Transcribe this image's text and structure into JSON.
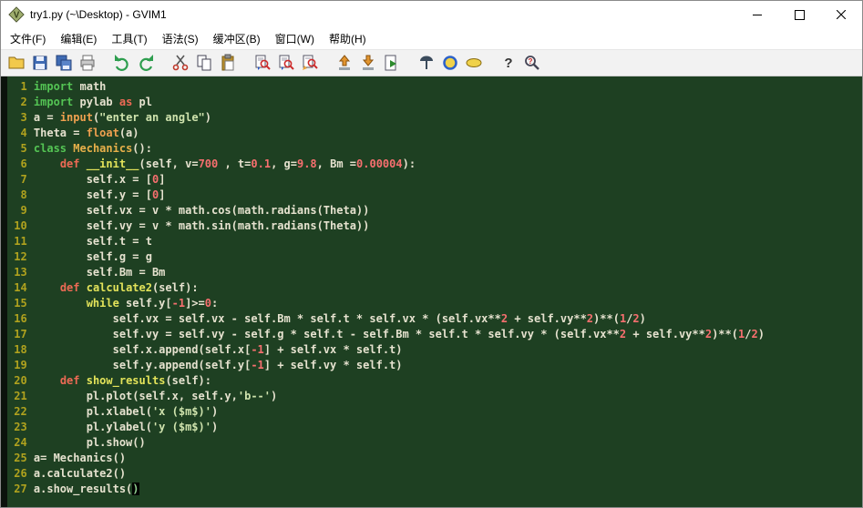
{
  "window": {
    "title": "try1.py (~\\Desktop) - GVIM1",
    "controls": [
      "minimize",
      "maximize",
      "close"
    ]
  },
  "menu": {
    "items": [
      {
        "key": "file",
        "label": "文件(F)"
      },
      {
        "key": "edit",
        "label": "编辑(E)"
      },
      {
        "key": "tools",
        "label": "工具(T)"
      },
      {
        "key": "syntax",
        "label": "语法(S)"
      },
      {
        "key": "buffers",
        "label": "缓冲区(B)"
      },
      {
        "key": "window",
        "label": "窗口(W)"
      },
      {
        "key": "help",
        "label": "帮助(H)"
      }
    ]
  },
  "toolbar": {
    "buttons": [
      {
        "name": "open",
        "icon": "open",
        "gap": false
      },
      {
        "name": "save",
        "icon": "save",
        "gap": false
      },
      {
        "name": "save-all",
        "icon": "saveall",
        "gap": false
      },
      {
        "name": "print",
        "icon": "print",
        "gap": false
      },
      {
        "name": "undo",
        "icon": "undo",
        "gap": true
      },
      {
        "name": "redo",
        "icon": "redo",
        "gap": false
      },
      {
        "name": "cut",
        "icon": "cut",
        "gap": true
      },
      {
        "name": "copy",
        "icon": "copy",
        "gap": false
      },
      {
        "name": "paste",
        "icon": "paste",
        "gap": false
      },
      {
        "name": "find-next",
        "icon": "findnext",
        "gap": true
      },
      {
        "name": "find-prev",
        "icon": "findprev",
        "gap": false
      },
      {
        "name": "find-replace",
        "icon": "replace",
        "gap": false
      },
      {
        "name": "load-session",
        "icon": "loadsesn",
        "gap": true
      },
      {
        "name": "save-session",
        "icon": "savesesn",
        "gap": false
      },
      {
        "name": "run-script",
        "icon": "runscript",
        "gap": false
      },
      {
        "name": "make",
        "icon": "make",
        "gap": true
      },
      {
        "name": "build-tags",
        "icon": "ctags",
        "gap": false
      },
      {
        "name": "jump-to-tag",
        "icon": "tagjump",
        "gap": false
      },
      {
        "name": "help",
        "icon": "help",
        "gap": true
      },
      {
        "name": "find-help",
        "icon": "findhelp",
        "gap": false
      }
    ]
  },
  "palette": {
    "titlebar_bg": "#ffffff",
    "toolbar_bg": "#f2f2f2",
    "editor_bg": "#1e4022",
    "plain": "#e6e2cf",
    "keyword_green": "#54c454",
    "statement_red": "#ee6a55",
    "func_yellow": "#e3e35a",
    "builtin_orange": "#efa04f",
    "classname_orange": "#e8b04a",
    "number_red": "#f76f6f",
    "string_pale": "#cfe3ad",
    "line_number": "#b0a21e",
    "cursor_bg": "#000000"
  },
  "editor": {
    "cursor": {
      "line": 27,
      "col": 16
    },
    "lines": [
      {
        "n": 1,
        "s": [
          [
            "kw",
            "import"
          ],
          [
            "pl",
            " math"
          ]
        ]
      },
      {
        "n": 2,
        "s": [
          [
            "kw",
            "import"
          ],
          [
            "pl",
            " pylab "
          ],
          [
            "st",
            "as"
          ],
          [
            "pl",
            " pl"
          ]
        ]
      },
      {
        "n": 3,
        "s": [
          [
            "pl",
            "a = "
          ],
          [
            "bi",
            "input"
          ],
          [
            "pl",
            "("
          ],
          [
            "str",
            "\"enter an angle\""
          ],
          [
            "pl",
            ")"
          ]
        ]
      },
      {
        "n": 4,
        "s": [
          [
            "pl",
            "Theta = "
          ],
          [
            "bi",
            "float"
          ],
          [
            "pl",
            "(a)"
          ]
        ]
      },
      {
        "n": 5,
        "s": [
          [
            "kw",
            "class"
          ],
          [
            "pl",
            " "
          ],
          [
            "cl",
            "Mechanics"
          ],
          [
            "pl",
            "():"
          ]
        ]
      },
      {
        "n": 6,
        "s": [
          [
            "pl",
            "    "
          ],
          [
            "st",
            "def"
          ],
          [
            "pl",
            " "
          ],
          [
            "fn",
            "__init__"
          ],
          [
            "pl",
            "(self, v="
          ],
          [
            "num",
            "700"
          ],
          [
            "pl",
            " , t="
          ],
          [
            "num",
            "0.1"
          ],
          [
            "pl",
            ", g="
          ],
          [
            "num",
            "9.8"
          ],
          [
            "pl",
            ", Bm ="
          ],
          [
            "num",
            "0.00004"
          ],
          [
            "pl",
            "):"
          ]
        ]
      },
      {
        "n": 7,
        "s": [
          [
            "pl",
            "        self.x = ["
          ],
          [
            "num",
            "0"
          ],
          [
            "pl",
            "]"
          ]
        ]
      },
      {
        "n": 8,
        "s": [
          [
            "pl",
            "        self.y = ["
          ],
          [
            "num",
            "0"
          ],
          [
            "pl",
            "]"
          ]
        ]
      },
      {
        "n": 9,
        "s": [
          [
            "pl",
            "        self.vx = v * math.cos(math.radians(Theta))"
          ]
        ]
      },
      {
        "n": 10,
        "s": [
          [
            "pl",
            "        self.vy = v * math.sin(math.radians(Theta))"
          ]
        ]
      },
      {
        "n": 11,
        "s": [
          [
            "pl",
            "        self.t = t"
          ]
        ]
      },
      {
        "n": 12,
        "s": [
          [
            "pl",
            "        self.g = g"
          ]
        ]
      },
      {
        "n": 13,
        "s": [
          [
            "pl",
            "        self.Bm = Bm"
          ]
        ]
      },
      {
        "n": 14,
        "s": [
          [
            "pl",
            "    "
          ],
          [
            "st",
            "def"
          ],
          [
            "pl",
            " "
          ],
          [
            "fn",
            "calculate2"
          ],
          [
            "pl",
            "(self):"
          ]
        ]
      },
      {
        "n": 15,
        "s": [
          [
            "pl",
            "        "
          ],
          [
            "fn",
            "while"
          ],
          [
            "pl",
            " self.y["
          ],
          [
            "num",
            "-1"
          ],
          [
            "pl",
            "]>="
          ],
          [
            "num",
            "0"
          ],
          [
            "pl",
            ":"
          ]
        ]
      },
      {
        "n": 16,
        "s": [
          [
            "pl",
            "            self.vx = self.vx - self.Bm * self.t * self.vx * (self.vx**"
          ],
          [
            "num",
            "2"
          ],
          [
            "pl",
            " + self.vy**"
          ],
          [
            "num",
            "2"
          ],
          [
            "pl",
            ")**("
          ],
          [
            "num",
            "1"
          ],
          [
            "pl",
            "/"
          ],
          [
            "num",
            "2"
          ],
          [
            "pl",
            ")"
          ]
        ]
      },
      {
        "n": 17,
        "s": [
          [
            "pl",
            "            self.vy = self.vy - self.g * self.t - self.Bm * self.t * self.vy * (self.vx**"
          ],
          [
            "num",
            "2"
          ],
          [
            "pl",
            " + self.vy**"
          ],
          [
            "num",
            "2"
          ],
          [
            "pl",
            ")**("
          ],
          [
            "num",
            "1"
          ],
          [
            "pl",
            "/"
          ],
          [
            "num",
            "2"
          ],
          [
            "pl",
            ")"
          ]
        ]
      },
      {
        "n": 18,
        "s": [
          [
            "pl",
            "            self.x.append(self.x["
          ],
          [
            "num",
            "-1"
          ],
          [
            "pl",
            "] + self.vx * self.t)"
          ]
        ]
      },
      {
        "n": 19,
        "s": [
          [
            "pl",
            "            self.y.append(self.y["
          ],
          [
            "num",
            "-1"
          ],
          [
            "pl",
            "] + self.vy * self.t)"
          ]
        ]
      },
      {
        "n": 20,
        "s": [
          [
            "pl",
            "    "
          ],
          [
            "st",
            "def"
          ],
          [
            "pl",
            " "
          ],
          [
            "fn",
            "show_results"
          ],
          [
            "pl",
            "(self):"
          ]
        ]
      },
      {
        "n": 21,
        "s": [
          [
            "pl",
            "        pl.plot(self.x, self.y,"
          ],
          [
            "str",
            "'b--'"
          ],
          [
            "pl",
            ")"
          ]
        ]
      },
      {
        "n": 22,
        "s": [
          [
            "pl",
            "        pl.xlabel("
          ],
          [
            "str",
            "'x ($m$)'"
          ],
          [
            "pl",
            ")"
          ]
        ]
      },
      {
        "n": 23,
        "s": [
          [
            "pl",
            "        pl.ylabel("
          ],
          [
            "str",
            "'y ($m$)'"
          ],
          [
            "pl",
            ")"
          ]
        ]
      },
      {
        "n": 24,
        "s": [
          [
            "pl",
            "        pl.show()"
          ]
        ]
      },
      {
        "n": 25,
        "s": [
          [
            "pl",
            "a= Mechanics()"
          ]
        ]
      },
      {
        "n": 26,
        "s": [
          [
            "pl",
            "a.calculate2()"
          ]
        ]
      },
      {
        "n": 27,
        "s": [
          [
            "pl",
            "a.show_results("
          ],
          [
            "cur",
            ")"
          ]
        ]
      }
    ]
  }
}
